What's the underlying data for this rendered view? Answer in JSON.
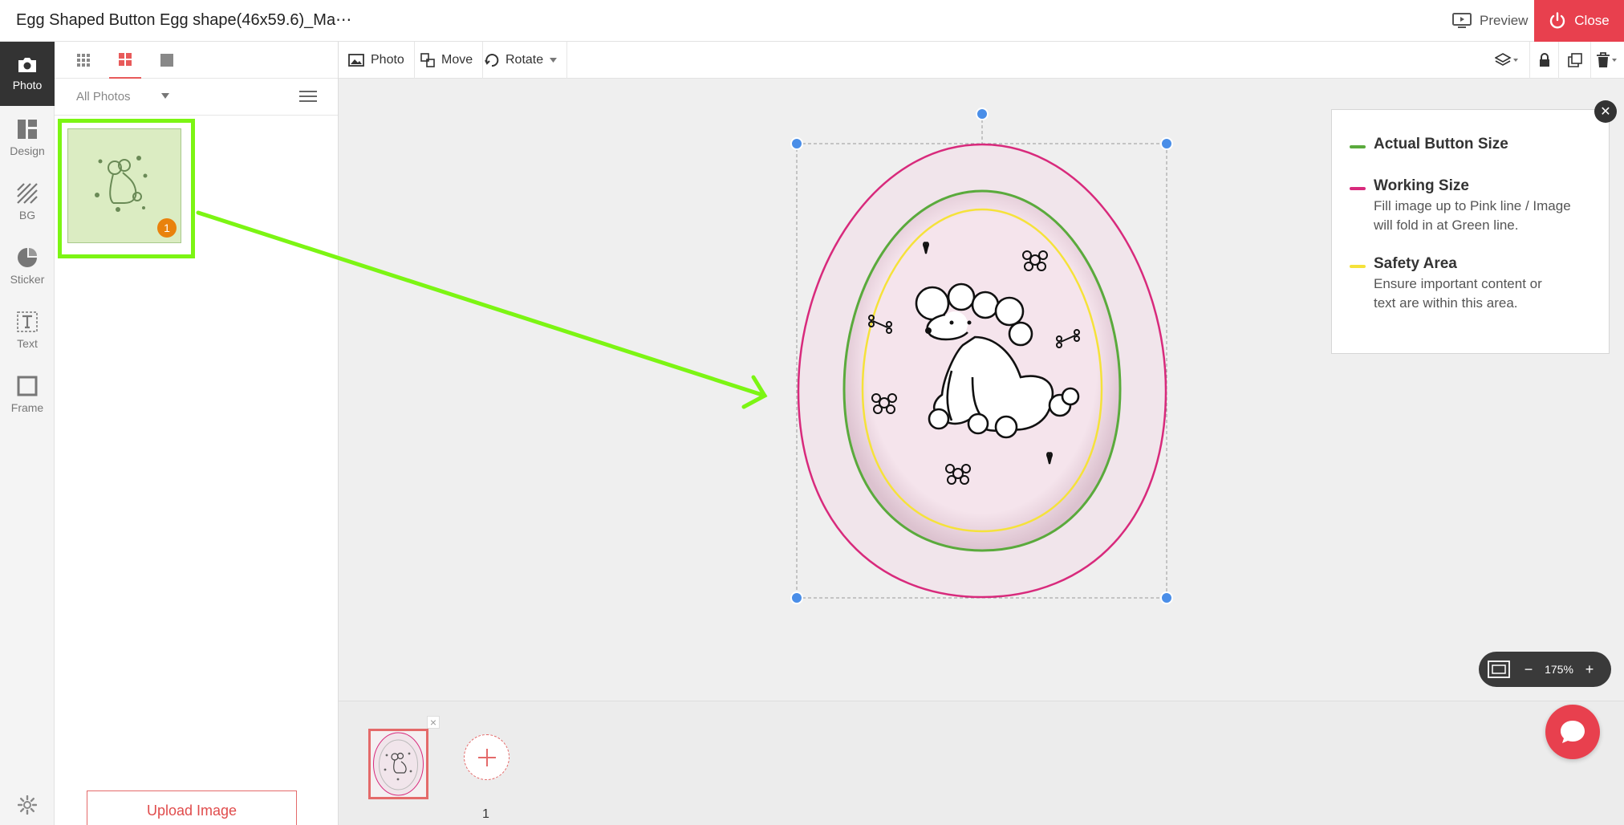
{
  "header": {
    "title": "Egg Shaped Button Egg shape(46x59.6)_Ma⋯",
    "preview_label": "Preview",
    "close_label": "Close"
  },
  "rail": {
    "items": [
      {
        "label": "Photo",
        "icon": "camera-icon"
      },
      {
        "label": "Design",
        "icon": "layout-icon"
      },
      {
        "label": "BG",
        "icon": "hatch-icon"
      },
      {
        "label": "Sticker",
        "icon": "sticker-icon"
      },
      {
        "label": "Text",
        "icon": "text-icon"
      },
      {
        "label": "Frame",
        "icon": "frame-icon"
      }
    ],
    "settings_icon": "gear-icon"
  },
  "panel": {
    "view_tabs": [
      "small-grid-icon",
      "large-grid-icon",
      "single-view-icon"
    ],
    "active_tab": "large-grid-icon",
    "filter_label": "All Photos",
    "photo_usage_count": "1",
    "upload_label": "Upload Image"
  },
  "toolbar": {
    "photo_label": "Photo",
    "move_label": "Move",
    "rotate_label": "Rotate",
    "right_icons": [
      "layers-icon",
      "lock-icon",
      "duplicate-icon",
      "trash-icon"
    ]
  },
  "legend": {
    "items": [
      {
        "title": "Actual Button Size",
        "desc_lines": [],
        "color": "#5aaa3c"
      },
      {
        "title": "Working Size",
        "desc_lines": [
          "Fill image up to Pink line / Image",
          "will fold in at Green line."
        ],
        "color": "#d82a7c"
      },
      {
        "title": "Safety Area",
        "desc_lines": [
          "Ensure important content or",
          "text are within this area."
        ],
        "color": "#f5e23a"
      }
    ]
  },
  "zoom": {
    "minus": "−",
    "value": "175%",
    "plus": "+"
  },
  "pages": {
    "current_number": "1"
  },
  "colors": {
    "accent_red": "#e8404e",
    "highlight_green": "#7cf513",
    "pink_line": "#d82a7c",
    "green_line": "#5aaa3c",
    "yellow_line": "#f5e23a",
    "handle_blue": "#4a8ee8",
    "badge_orange": "#e9820d"
  }
}
